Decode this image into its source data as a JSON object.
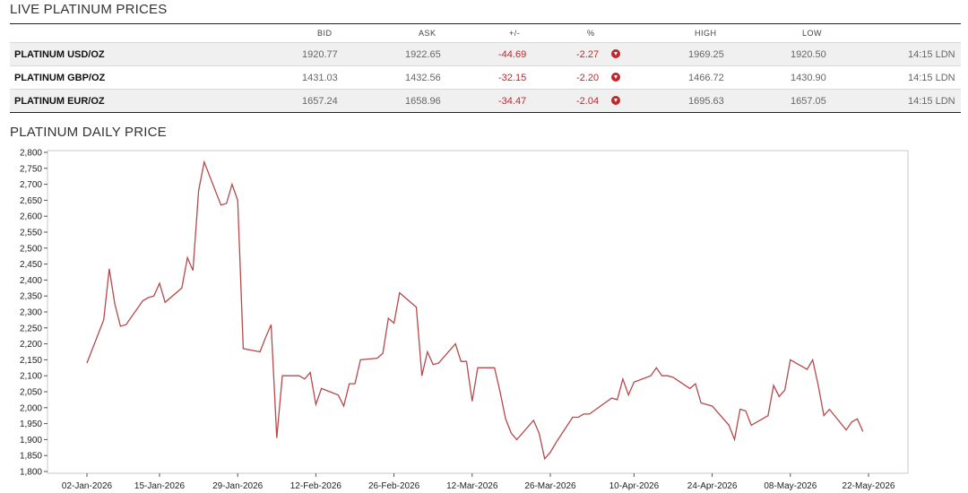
{
  "live_title": "LIVE PLATINUM PRICES",
  "daily_title": "PLATINUM DAILY PRICE",
  "table": {
    "headers": {
      "bid": "BID",
      "ask": "ASK",
      "change": "+/-",
      "pct": "%",
      "high": "HIGH",
      "low": "LOW"
    },
    "rows": [
      {
        "name": "PLATINUM USD/OZ",
        "bid": "1920.77",
        "ask": "1922.65",
        "change": "-44.69",
        "pct": "-2.27",
        "high": "1969.25",
        "low": "1920.50",
        "time": "14:15 LDN"
      },
      {
        "name": "PLATINUM GBP/OZ",
        "bid": "1431.03",
        "ask": "1432.56",
        "change": "-32.15",
        "pct": "-2.20",
        "high": "1466.72",
        "low": "1430.90",
        "time": "14:15 LDN"
      },
      {
        "name": "PLATINUM EUR/OZ",
        "bid": "1657.24",
        "ask": "1658.96",
        "change": "-34.47",
        "pct": "-2.04",
        "high": "1695.63",
        "low": "1657.05",
        "time": "14:15 LDN"
      }
    ],
    "down_icon": "circle-down-arrow-icon"
  },
  "colors": {
    "line": "#b5494c",
    "negative": "#c0272d",
    "rule": "#222222"
  },
  "chart_data": {
    "type": "line",
    "title": "PLATINUM DAILY PRICE",
    "xlabel": "",
    "ylabel": "",
    "ylim": [
      1800,
      2800
    ],
    "grid": false,
    "y_ticks": [
      "1,800",
      "1,850",
      "1,900",
      "1,950",
      "2,000",
      "2,050",
      "2,100",
      "2,150",
      "2,200",
      "2,250",
      "2,300",
      "2,350",
      "2,400",
      "2,450",
      "2,500",
      "2,550",
      "2,600",
      "2,650",
      "2,700",
      "2,750",
      "2,800"
    ],
    "x_ticks": [
      "02-Jan-2026",
      "15-Jan-2026",
      "29-Jan-2026",
      "12-Feb-2026",
      "26-Feb-2026",
      "12-Mar-2026",
      "26-Mar-2026",
      "10-Apr-2026",
      "24-Apr-2026",
      "08-May-2026",
      "22-May-2026"
    ],
    "series": [
      {
        "values": [
          [
            "2026-01-02",
            2140
          ],
          [
            "2026-01-05",
            2275
          ],
          [
            "2026-01-06",
            2435
          ],
          [
            "2026-01-07",
            2325
          ],
          [
            "2026-01-08",
            2255
          ],
          [
            "2026-01-09",
            2260
          ],
          [
            "2026-01-12",
            2335
          ],
          [
            "2026-01-13",
            2345
          ],
          [
            "2026-01-14",
            2350
          ],
          [
            "2026-01-15",
            2390
          ],
          [
            "2026-01-16",
            2330
          ],
          [
            "2026-01-19",
            2375
          ],
          [
            "2026-01-20",
            2470
          ],
          [
            "2026-01-21",
            2430
          ],
          [
            "2026-01-22",
            2680
          ],
          [
            "2026-01-23",
            2770
          ],
          [
            "2026-01-26",
            2635
          ],
          [
            "2026-01-27",
            2640
          ],
          [
            "2026-01-28",
            2700
          ],
          [
            "2026-01-29",
            2650
          ],
          [
            "2026-01-30",
            2185
          ],
          [
            "2026-02-02",
            2175
          ],
          [
            "2026-02-03",
            2220
          ],
          [
            "2026-02-04",
            2260
          ],
          [
            "2026-02-05",
            1905
          ],
          [
            "2026-02-06",
            2100
          ],
          [
            "2026-02-09",
            2100
          ],
          [
            "2026-02-10",
            2090
          ],
          [
            "2026-02-11",
            2110
          ],
          [
            "2026-02-12",
            2010
          ],
          [
            "2026-02-13",
            2060
          ],
          [
            "2026-02-16",
            2040
          ],
          [
            "2026-02-17",
            2005
          ],
          [
            "2026-02-18",
            2075
          ],
          [
            "2026-02-19",
            2075
          ],
          [
            "2026-02-20",
            2150
          ],
          [
            "2026-02-23",
            2155
          ],
          [
            "2026-02-24",
            2170
          ],
          [
            "2026-02-25",
            2280
          ],
          [
            "2026-02-26",
            2265
          ],
          [
            "2026-02-27",
            2360
          ],
          [
            "2026-03-02",
            2315
          ],
          [
            "2026-03-03",
            2100
          ],
          [
            "2026-03-04",
            2175
          ],
          [
            "2026-03-05",
            2135
          ],
          [
            "2026-03-06",
            2140
          ],
          [
            "2026-03-09",
            2200
          ],
          [
            "2026-03-10",
            2145
          ],
          [
            "2026-03-11",
            2145
          ],
          [
            "2026-03-12",
            2020
          ],
          [
            "2026-03-13",
            2125
          ],
          [
            "2026-03-16",
            2125
          ],
          [
            "2026-03-17",
            2050
          ],
          [
            "2026-03-18",
            1965
          ],
          [
            "2026-03-19",
            1920
          ],
          [
            "2026-03-20",
            1900
          ],
          [
            "2026-03-23",
            1960
          ],
          [
            "2026-03-24",
            1920
          ],
          [
            "2026-03-25",
            1840
          ],
          [
            "2026-03-26",
            1860
          ],
          [
            "2026-03-27",
            1890
          ],
          [
            "2026-03-30",
            1970
          ],
          [
            "2026-03-31",
            1970
          ],
          [
            "2026-04-01",
            1980
          ],
          [
            "2026-04-02",
            1980
          ],
          [
            "2026-04-06",
            2030
          ],
          [
            "2026-04-07",
            2025
          ],
          [
            "2026-04-08",
            2090
          ],
          [
            "2026-04-09",
            2040
          ],
          [
            "2026-04-10",
            2080
          ],
          [
            "2026-04-13",
            2100
          ],
          [
            "2026-04-14",
            2125
          ],
          [
            "2026-04-15",
            2100
          ],
          [
            "2026-04-16",
            2100
          ],
          [
            "2026-04-17",
            2095
          ],
          [
            "2026-04-20",
            2060
          ],
          [
            "2026-04-21",
            2075
          ],
          [
            "2026-04-22",
            2015
          ],
          [
            "2026-04-23",
            2010
          ],
          [
            "2026-04-24",
            2005
          ],
          [
            "2026-04-27",
            1945
          ],
          [
            "2026-04-28",
            1900
          ],
          [
            "2026-04-29",
            1995
          ],
          [
            "2026-04-30",
            1990
          ],
          [
            "2026-05-01",
            1945
          ],
          [
            "2026-05-04",
            1975
          ],
          [
            "2026-05-05",
            2070
          ],
          [
            "2026-05-06",
            2035
          ],
          [
            "2026-05-07",
            2055
          ],
          [
            "2026-05-08",
            2150
          ],
          [
            "2026-05-11",
            2120
          ],
          [
            "2026-05-12",
            2150
          ],
          [
            "2026-05-13",
            2070
          ],
          [
            "2026-05-14",
            1975
          ],
          [
            "2026-05-15",
            1995
          ],
          [
            "2026-05-18",
            1930
          ],
          [
            "2026-05-19",
            1955
          ],
          [
            "2026-05-20",
            1965
          ],
          [
            "2026-05-21",
            1925
          ]
        ]
      }
    ]
  }
}
